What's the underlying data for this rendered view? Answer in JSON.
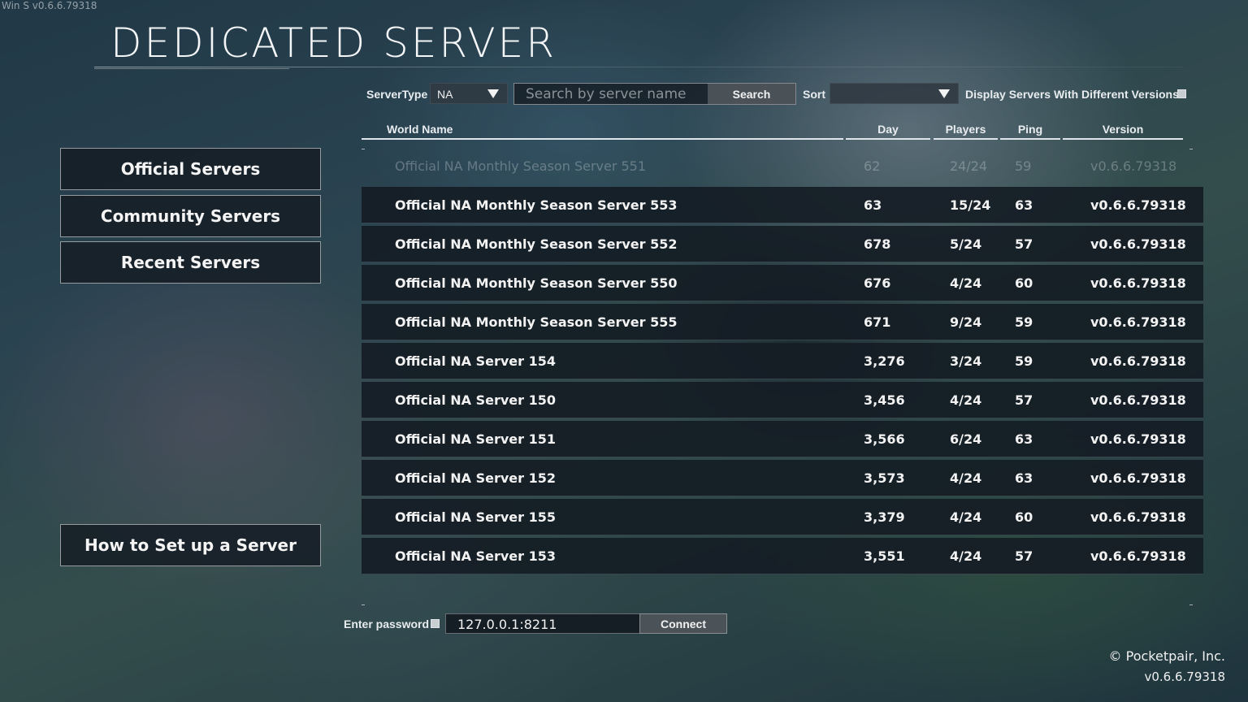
{
  "build_tag": "Win S v0.6.6.79318",
  "title": "DEDICATED SERVER",
  "toolbar": {
    "server_type_label": "ServerType",
    "server_type_value": "NA",
    "search_placeholder": "Search by server name",
    "search_button": "Search",
    "sort_label": "Sort",
    "sort_value": "",
    "different_versions_label": "Display Servers With Different Versions"
  },
  "menu": {
    "official": "Official Servers",
    "community": "Community Servers",
    "recent": "Recent Servers",
    "howto": "How to Set up a Server"
  },
  "table": {
    "headers": {
      "name": "World Name",
      "day": "Day",
      "players": "Players",
      "ping": "Ping",
      "version": "Version"
    },
    "rows": [
      {
        "name": "Official NA Monthly Season Server 551",
        "day": "62",
        "players": "24/24",
        "ping": "59",
        "version": "v0.6.6.79318"
      },
      {
        "name": "Official NA Monthly Season Server 553",
        "day": "63",
        "players": "15/24",
        "ping": "63",
        "version": "v0.6.6.79318"
      },
      {
        "name": "Official NA Monthly Season Server 552",
        "day": "678",
        "players": "5/24",
        "ping": "57",
        "version": "v0.6.6.79318"
      },
      {
        "name": "Official NA Monthly Season Server 550",
        "day": "676",
        "players": "4/24",
        "ping": "60",
        "version": "v0.6.6.79318"
      },
      {
        "name": "Official NA Monthly Season Server 555",
        "day": "671",
        "players": "9/24",
        "ping": "59",
        "version": "v0.6.6.79318"
      },
      {
        "name": "Official NA Server 154",
        "day": "3,276",
        "players": "3/24",
        "ping": "59",
        "version": "v0.6.6.79318"
      },
      {
        "name": "Official NA Server 150",
        "day": "3,456",
        "players": "4/24",
        "ping": "57",
        "version": "v0.6.6.79318"
      },
      {
        "name": "Official NA Server 151",
        "day": "3,566",
        "players": "6/24",
        "ping": "63",
        "version": "v0.6.6.79318"
      },
      {
        "name": "Official NA Server 152",
        "day": "3,573",
        "players": "4/24",
        "ping": "63",
        "version": "v0.6.6.79318"
      },
      {
        "name": "Official NA Server 155",
        "day": "3,379",
        "players": "4/24",
        "ping": "60",
        "version": "v0.6.6.79318"
      },
      {
        "name": "Official NA Server 153",
        "day": "3,551",
        "players": "4/24",
        "ping": "57",
        "version": "v0.6.6.79318"
      }
    ]
  },
  "footer": {
    "password_label": "Enter password",
    "address_value": "127.0.0.1:8211",
    "connect_button": "Connect",
    "copyright": "© Pocketpair, Inc.",
    "version": "v0.6.6.79318"
  }
}
